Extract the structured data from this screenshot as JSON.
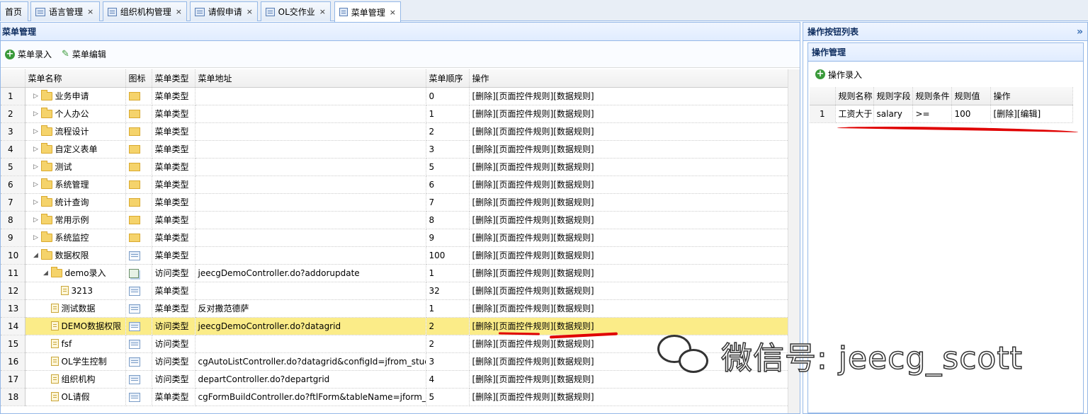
{
  "tabs": [
    {
      "label": "首页",
      "icon": "none"
    },
    {
      "label": "语言管理",
      "icon": "grid-icon",
      "closable": true
    },
    {
      "label": "组织机构管理",
      "icon": "grid-icon",
      "closable": true
    },
    {
      "label": "请假申请",
      "icon": "grid-icon",
      "closable": true
    },
    {
      "label": "OL交作业",
      "icon": "grid-icon",
      "closable": true
    },
    {
      "label": "菜单管理",
      "icon": "grid-icon",
      "closable": true,
      "active": true
    }
  ],
  "close_glyph": "×",
  "left_panel": {
    "title": "菜单管理",
    "toolbar": {
      "add_label": "菜单录入",
      "edit_label": "菜单编辑"
    },
    "columns": [
      "菜单名称",
      "图标",
      "菜单类型",
      "菜单地址",
      "菜单顺序",
      "操作"
    ],
    "rows": [
      {
        "no": "1",
        "name": "业务申请",
        "node": "folder",
        "arrow": "right",
        "depth": 0,
        "icon": "folder",
        "type": "菜单类型",
        "url": "",
        "order": "0",
        "ops": "[删除][页面控件规则][数据规则]"
      },
      {
        "no": "2",
        "name": "个人办公",
        "node": "folder",
        "arrow": "right",
        "depth": 0,
        "icon": "folder",
        "type": "菜单类型",
        "url": "",
        "order": "1",
        "ops": "[删除][页面控件规则][数据规则]"
      },
      {
        "no": "3",
        "name": "流程设计",
        "node": "folder",
        "arrow": "right",
        "depth": 0,
        "icon": "folder",
        "type": "菜单类型",
        "url": "",
        "order": "2",
        "ops": "[删除][页面控件规则][数据规则]"
      },
      {
        "no": "4",
        "name": "自定义表单",
        "node": "folder",
        "arrow": "right",
        "depth": 0,
        "icon": "folder",
        "type": "菜单类型",
        "url": "",
        "order": "3",
        "ops": "[删除][页面控件规则][数据规则]"
      },
      {
        "no": "5",
        "name": "测试",
        "node": "folder",
        "arrow": "right",
        "depth": 0,
        "icon": "folder",
        "type": "菜单类型",
        "url": "",
        "order": "5",
        "ops": "[删除][页面控件规则][数据规则]"
      },
      {
        "no": "6",
        "name": "系统管理",
        "node": "folder",
        "arrow": "right",
        "depth": 0,
        "icon": "folder",
        "type": "菜单类型",
        "url": "",
        "order": "6",
        "ops": "[删除][页面控件规则][数据规则]"
      },
      {
        "no": "7",
        "name": "统计查询",
        "node": "folder",
        "arrow": "right",
        "depth": 0,
        "icon": "folder",
        "type": "菜单类型",
        "url": "",
        "order": "7",
        "ops": "[删除][页面控件规则][数据规则]"
      },
      {
        "no": "8",
        "name": "常用示例",
        "node": "folder",
        "arrow": "right",
        "depth": 0,
        "icon": "folder",
        "type": "菜单类型",
        "url": "",
        "order": "8",
        "ops": "[删除][页面控件规则][数据规则]"
      },
      {
        "no": "9",
        "name": "系统监控",
        "node": "folder",
        "arrow": "right",
        "depth": 0,
        "icon": "folder",
        "type": "菜单类型",
        "url": "",
        "order": "9",
        "ops": "[删除][页面控件规则][数据规则]"
      },
      {
        "no": "10",
        "name": "数据权限",
        "node": "folder",
        "arrow": "down",
        "depth": 0,
        "icon": "grid",
        "type": "菜单类型",
        "url": "",
        "order": "100",
        "ops": "[删除][页面控件规则][数据规则]"
      },
      {
        "no": "11",
        "name": "demo录入",
        "node": "folder",
        "arrow": "down",
        "depth": 1,
        "icon": "multi",
        "type": "访问类型",
        "url": "jeecgDemoController.do?addorupdate",
        "order": "1",
        "ops": "[删除][页面控件规则][数据规则]"
      },
      {
        "no": "12",
        "name": "3213",
        "node": "file",
        "arrow": "",
        "depth": 2,
        "icon": "grid",
        "type": "菜单类型",
        "url": "",
        "order": "32",
        "ops": "[删除][页面控件规则][数据规则]"
      },
      {
        "no": "13",
        "name": "测试数据",
        "node": "file",
        "arrow": "",
        "depth": 1,
        "icon": "grid",
        "type": "菜单类型",
        "url": "反对撒范德萨",
        "order": "1",
        "ops": "[删除][页面控件规则][数据规则]"
      },
      {
        "no": "14",
        "name": "DEMO数据权限",
        "node": "file",
        "arrow": "",
        "depth": 1,
        "icon": "grid",
        "type": "访问类型",
        "url": "jeecgDemoController.do?datagrid",
        "order": "2",
        "ops": "[删除][页面控件规则][数据规则]",
        "selected": true
      },
      {
        "no": "15",
        "name": "fsf",
        "node": "file",
        "arrow": "",
        "depth": 1,
        "icon": "grid",
        "type": "访问类型",
        "url": "",
        "order": "2",
        "ops": "[删除][页面控件规则][数据规则]"
      },
      {
        "no": "16",
        "name": "OL学生控制",
        "node": "file",
        "arrow": "",
        "depth": 1,
        "icon": "grid",
        "type": "访问类型",
        "url": "cgAutoListController.do?datagrid&configId=jfrom_student",
        "order": "3",
        "ops": "[删除][页面控件规则][数据规则]"
      },
      {
        "no": "17",
        "name": "组织机构",
        "node": "file",
        "arrow": "",
        "depth": 1,
        "icon": "grid",
        "type": "访问类型",
        "url": "departController.do?departgrid",
        "order": "4",
        "ops": "[删除][页面控件规则][数据规则]"
      },
      {
        "no": "18",
        "name": "OL请假",
        "node": "file",
        "arrow": "",
        "depth": 1,
        "icon": "grid",
        "type": "菜单类型",
        "url": "cgFormBuildController.do?ftlForm&tableName=jform_leave",
        "order": "5",
        "ops": "[删除][页面控件规则][数据规则]"
      }
    ]
  },
  "right_panel": {
    "title": "操作按钮列表",
    "collapse_glyph": "»",
    "sub_title": "操作管理",
    "add_label": "操作录入",
    "columns": [
      "规则名称",
      "规则字段",
      "规则条件",
      "规则值",
      "操作"
    ],
    "rows": [
      {
        "no": "1",
        "name": "工资大于",
        "field": "salary",
        "cond": ">=",
        "value": "100",
        "ops": "[删除][编辑]"
      }
    ]
  },
  "watermark": {
    "text": "微信号: jeecg_scott",
    "icon": "wechat-icon"
  },
  "annotation_color": "#e00000"
}
